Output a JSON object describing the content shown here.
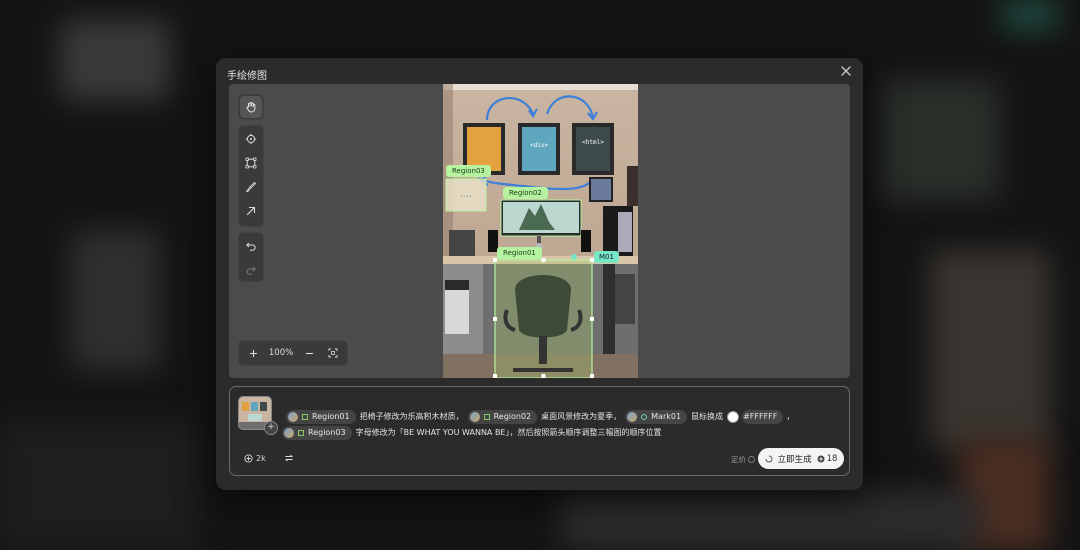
{
  "modal": {
    "title": "手绘修图"
  },
  "zoom": {
    "level": "100%"
  },
  "photo_labels": {
    "region01": "Region01",
    "region02": "Region02",
    "region03": "Region03",
    "mark01": "M01",
    "frame_center_text": "<div>",
    "frame_right_text": "<html>"
  },
  "prompt": {
    "line1": {
      "chip1": "Region01",
      "text1": "把椅子修改为乐高积木材质，",
      "chip2": "Region02",
      "text2": "桌面风景修改为夏季，",
      "chip3": "Mark01",
      "text3": "鼠标换成",
      "color_hex": "#FFFFFF",
      "text4": "，"
    },
    "line2": {
      "chip1": "Region03",
      "text1": "字母修改为「BE WHAT YOU WANNA BE」，然后按照箭头顺序调整三幅图的顺序位置"
    }
  },
  "footer": {
    "resolution": "2k",
    "price_label": "定价",
    "generate_label": "立即生成",
    "cost": "18"
  },
  "colors": {
    "region_label": "#b6f3a1",
    "mark_label": "#78e6c4",
    "accent_arrow": "#3d7fd9"
  }
}
